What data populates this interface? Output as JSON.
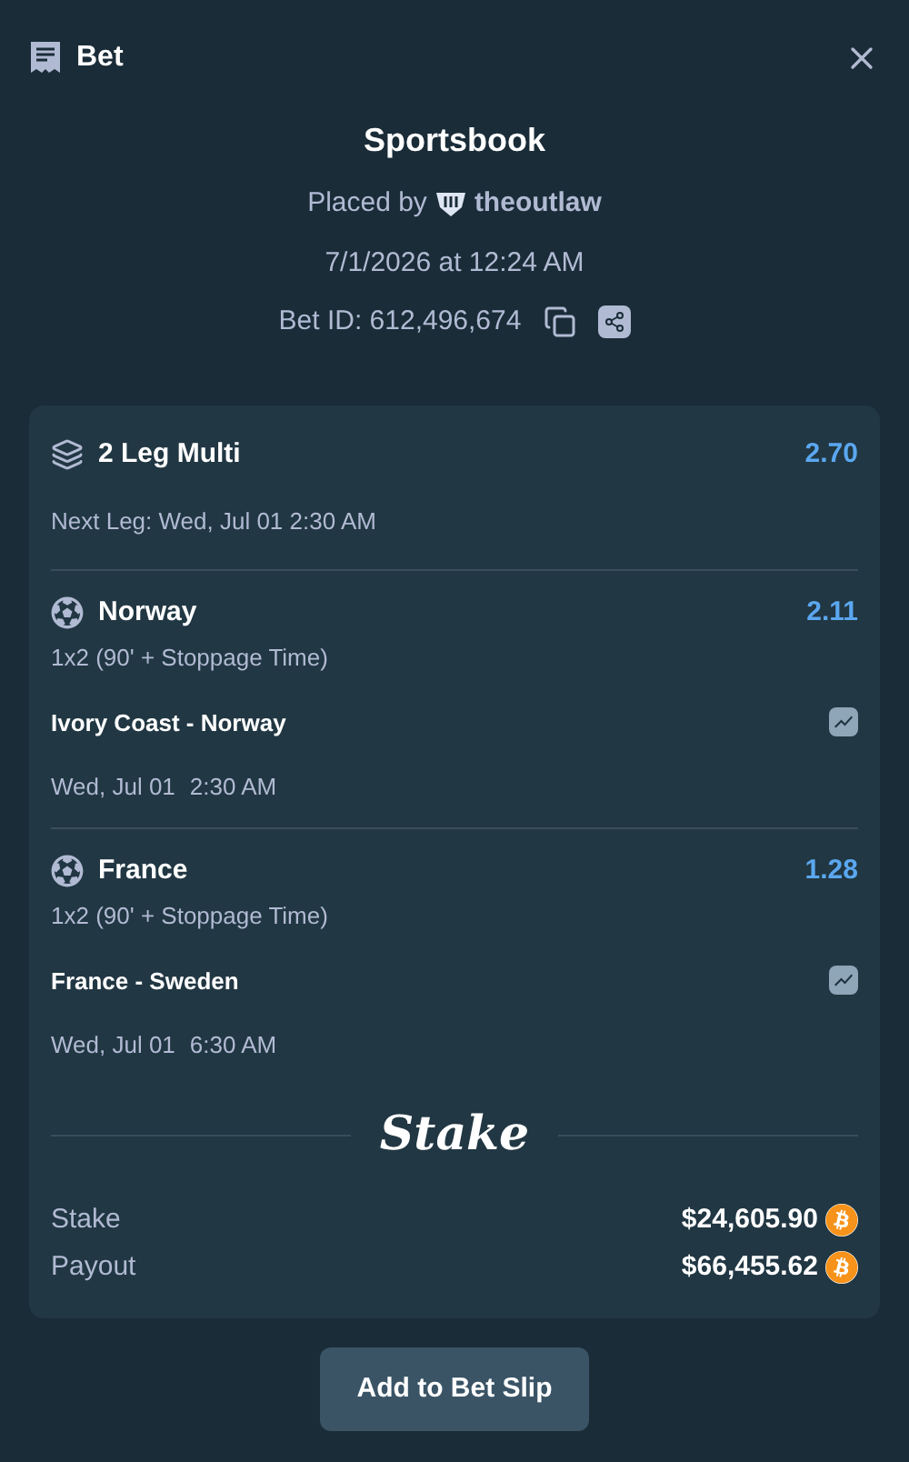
{
  "header": {
    "title": "Bet"
  },
  "summary": {
    "title": "Sportsbook",
    "placed_by_label": "Placed by",
    "user": "theoutlaw",
    "date": "7/1/2026 at 12:24 AM",
    "bet_id": "Bet ID: 612,496,674"
  },
  "multi": {
    "title": "2 Leg Multi",
    "odds": "2.70",
    "next_leg": "Next Leg: Wed, Jul 01 2:30 AM"
  },
  "legs": [
    {
      "selection": "Norway",
      "odds": "2.11",
      "market": "1x2 (90' + Stoppage Time)",
      "match": "Ivory Coast - Norway",
      "date": "Wed, Jul 01",
      "time": "2:30 AM"
    },
    {
      "selection": "France",
      "odds": "1.28",
      "market": "1x2 (90' + Stoppage Time)",
      "match": "France - Sweden",
      "date": "Wed, Jul 01",
      "time": "6:30 AM"
    }
  ],
  "brand": "Stake",
  "totals": [
    {
      "label": "Stake",
      "amount": "$24,605.90"
    },
    {
      "label": "Payout",
      "amount": "$66,455.62"
    }
  ],
  "action": "Add to Bet Slip"
}
